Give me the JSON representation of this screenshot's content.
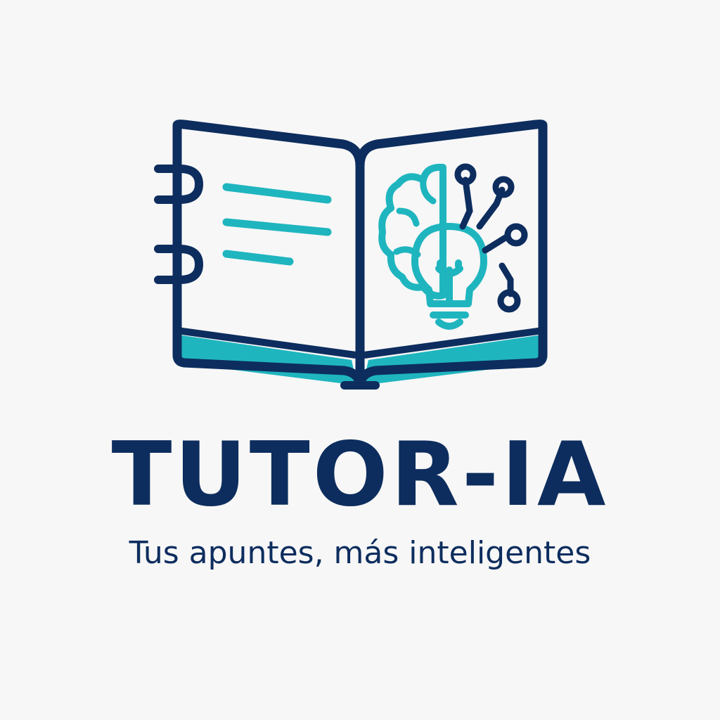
{
  "brand": {
    "name": "TUTOR-IA",
    "tagline": "Tus apuntes, más inteligentes"
  },
  "logo": {
    "icon": "open-notebook-with-brain-lightbulb-icon",
    "colors": {
      "navy": "#0d2d5e",
      "teal": "#1fb5bf",
      "background": "#f7f7f7"
    }
  }
}
